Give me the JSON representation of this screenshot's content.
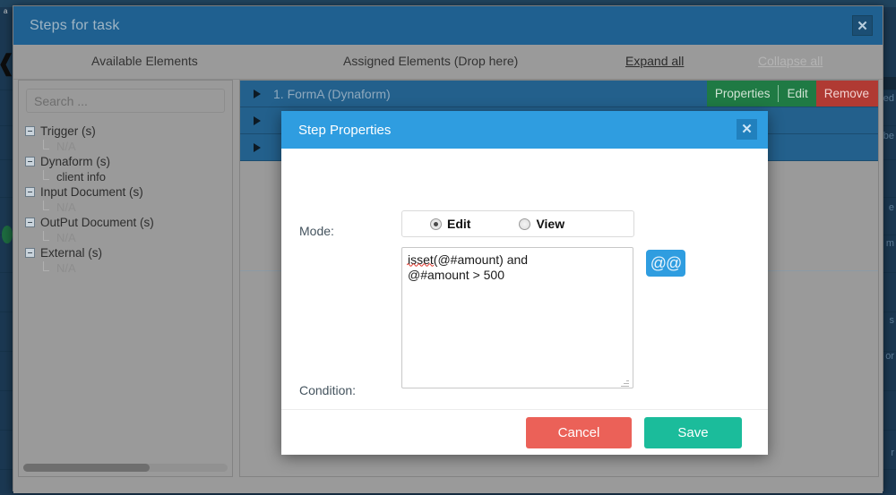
{
  "background": {
    "corner_label": "a",
    "ghost_lines": [
      "ed",
      "be",
      "e",
      "m",
      "s",
      "or",
      "r"
    ]
  },
  "steps_modal": {
    "title": "Steps for task",
    "close_icon": "✕",
    "columns": {
      "available": "Available Elements",
      "assigned": "Assigned Elements (Drop here)",
      "expand_all": "Expand all",
      "collapse_all": "Collapse all"
    },
    "left_panel": {
      "search_placeholder": "Search ...",
      "search_value": "",
      "tree": [
        {
          "label": "Trigger (s)",
          "children": [
            {
              "label": "N/A",
              "real": false
            }
          ]
        },
        {
          "label": "Dynaform (s)",
          "children": [
            {
              "label": "client info",
              "real": true
            }
          ]
        },
        {
          "label": "Input Document (s)",
          "children": [
            {
              "label": "N/A",
              "real": false
            }
          ]
        },
        {
          "label": "OutPut Document (s)",
          "children": [
            {
              "label": "N/A",
              "real": false
            }
          ]
        },
        {
          "label": "External (s)",
          "children": [
            {
              "label": "N/A",
              "real": false
            }
          ]
        }
      ]
    },
    "assigned_rows": [
      {
        "name": "1. FormA (Dynaform)",
        "actions": {
          "properties": "Properties",
          "edit": "Edit",
          "remove": "Remove"
        }
      },
      {
        "name": "",
        "actions": null
      },
      {
        "name": "",
        "actions": null
      }
    ]
  },
  "step_properties": {
    "title": "Step Properties",
    "close_icon": "✕",
    "mode_label": "Mode:",
    "mode_options": [
      {
        "label": "Edit",
        "selected": true
      },
      {
        "label": "View",
        "selected": false
      }
    ],
    "condition_label": "Condition:",
    "condition_value": "isset(@#amount) and\n@#amount > 500",
    "condition_line1": "isset(@#amount) and",
    "condition_line1_misspelled": "isset",
    "condition_line1_rest": "(@#amount) and",
    "condition_line2": "@#amount > 500",
    "at_button_label": "@@",
    "cancel_label": "Cancel",
    "save_label": "Save"
  },
  "colors": {
    "outer_header": "#1f6090",
    "inner_header": "#2f9de0",
    "panel_gray": "#9a9a9a",
    "row_blue": "#23608c",
    "green_action": "#1f7a44",
    "red_action": "#b03a33",
    "cancel_red": "#eb6158",
    "save_green": "#1bbc9b",
    "page_navy": "#1b3852"
  }
}
